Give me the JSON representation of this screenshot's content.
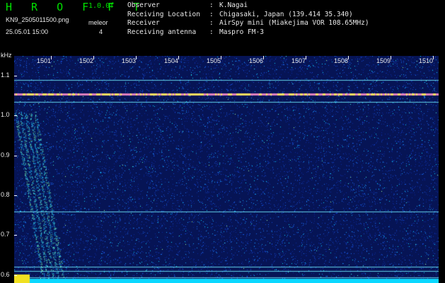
{
  "header": {
    "brand": "H R O F F T",
    "version": "1.0.0f",
    "filename": "KN9_2505011500.png",
    "datetime": "25.05.01 15:00",
    "mode_label": "meleor",
    "mode_value": "4"
  },
  "observation": [
    {
      "label": "Observer",
      "value": "K.Nagai"
    },
    {
      "label": "Receiving Location",
      "value": "Chigasaki, Japan (139.414 35.340)"
    },
    {
      "label": "Receiver",
      "value": "AirSpy mini (Miakejima VOR 108.65MHz)"
    },
    {
      "label": "Receiving antenna",
      "value": "Maspro FM-3"
    }
  ],
  "spectrogram": {
    "y_unit": "kHz",
    "y_ticks": [
      "1.1",
      "1.0",
      "0.9",
      "0.8",
      "0.7",
      "0.6"
    ],
    "y_range": [
      0.58,
      1.15
    ],
    "x_ticks": [
      "1501",
      "1502",
      "1503",
      "1504",
      "1505",
      "1506",
      "1507",
      "1508",
      "1509",
      "1510"
    ],
    "x_range_minutes": [
      1500.3,
      1510.3
    ],
    "carrier_lines_khz": [
      1.09,
      1.055,
      1.035,
      0.76,
      0.62,
      0.61,
      0.595
    ],
    "colors": {
      "background": "#061455",
      "carrier": "#d8f060",
      "grid": "#ffffff",
      "noise": "#0ad8ff"
    }
  }
}
